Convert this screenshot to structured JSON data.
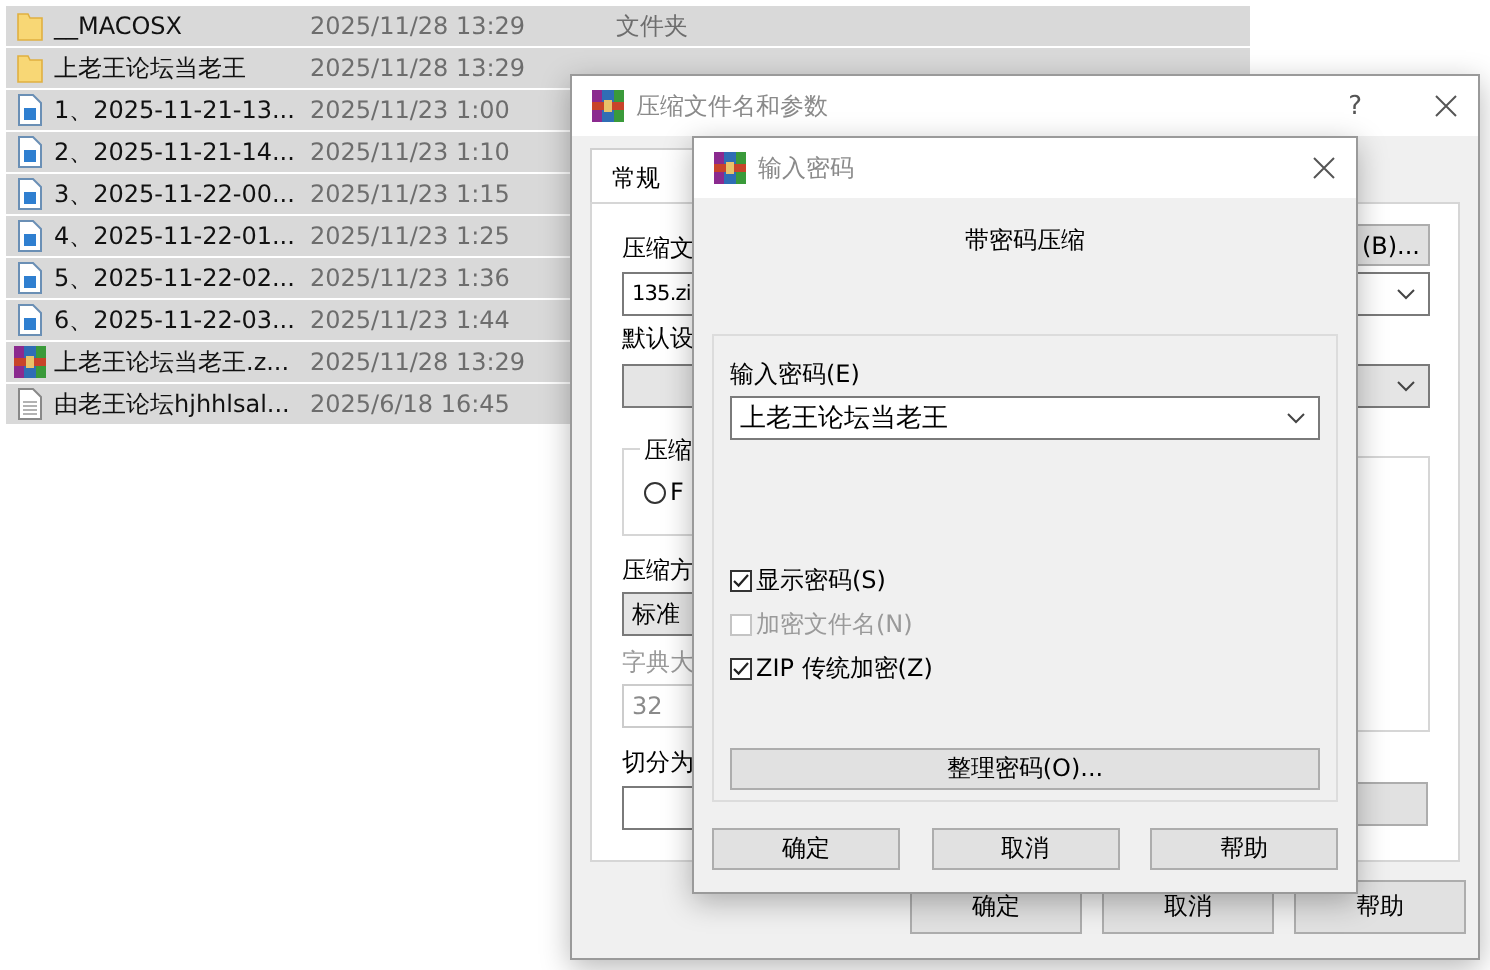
{
  "file_list": {
    "rows": [
      {
        "kind": "folder",
        "name": "__MACOSX",
        "modified": "2025/11/28 13:29",
        "type": "文件夹",
        "selected": true
      },
      {
        "kind": "folder",
        "name": "上老王论坛当老王",
        "modified": "2025/11/28 13:29",
        "selected": true
      },
      {
        "kind": "video",
        "name": "1、2025-11-21-13...",
        "modified": "2025/11/23 1:00",
        "selected": true
      },
      {
        "kind": "video",
        "name": "2、2025-11-21-14...",
        "modified": "2025/11/23 1:10",
        "selected": true
      },
      {
        "kind": "video",
        "name": "3、2025-11-22-00...",
        "modified": "2025/11/23 1:15",
        "selected": true
      },
      {
        "kind": "video",
        "name": "4、2025-11-22-01...",
        "modified": "2025/11/23 1:25",
        "selected": true
      },
      {
        "kind": "video",
        "name": "5、2025-11-22-02...",
        "modified": "2025/11/23 1:36",
        "selected": true
      },
      {
        "kind": "video",
        "name": "6、2025-11-22-03...",
        "modified": "2025/11/23 1:44",
        "selected": true
      },
      {
        "kind": "archive",
        "name": "上老王论坛当老王.z...",
        "modified": "2025/11/28 13:29",
        "selected": true
      },
      {
        "kind": "text",
        "name": "由老王论坛hjhhlsal...",
        "modified": "2025/6/18 16:45",
        "selected": true
      }
    ]
  },
  "archive_dialog": {
    "title": "压缩文件名和参数",
    "help": "?",
    "tabs": [
      {
        "label": "常规",
        "selected": true
      }
    ],
    "archive_name_label": "压缩文",
    "browse_button": "(B)...",
    "archive_name": "135.zi",
    "profile_label": "默认设",
    "group_label": "压缩",
    "radio": {
      "label": "F",
      "selected": false
    },
    "method_label": "压缩方",
    "method": "标准",
    "dictionary_label": "字典大",
    "dictionary": "32",
    "dictionary_disabled": true,
    "split_label": "切分为",
    "buttons": [
      "确定",
      "取消",
      "帮助"
    ]
  },
  "password_dialog": {
    "title": "输入密码",
    "heading": "带密码压缩",
    "password_label": "输入密码(E)",
    "password": "上老王论坛当老王",
    "options": [
      {
        "label": "显示密码(S)",
        "checked": true,
        "disabled": false
      },
      {
        "label": "加密文件名(N)",
        "checked": false,
        "disabled": true
      },
      {
        "label": "ZIP 传统加密(Z)",
        "checked": true,
        "disabled": false
      }
    ],
    "organize_button": "整理密码(O)...",
    "buttons": [
      "确定",
      "取消",
      "帮助"
    ]
  }
}
